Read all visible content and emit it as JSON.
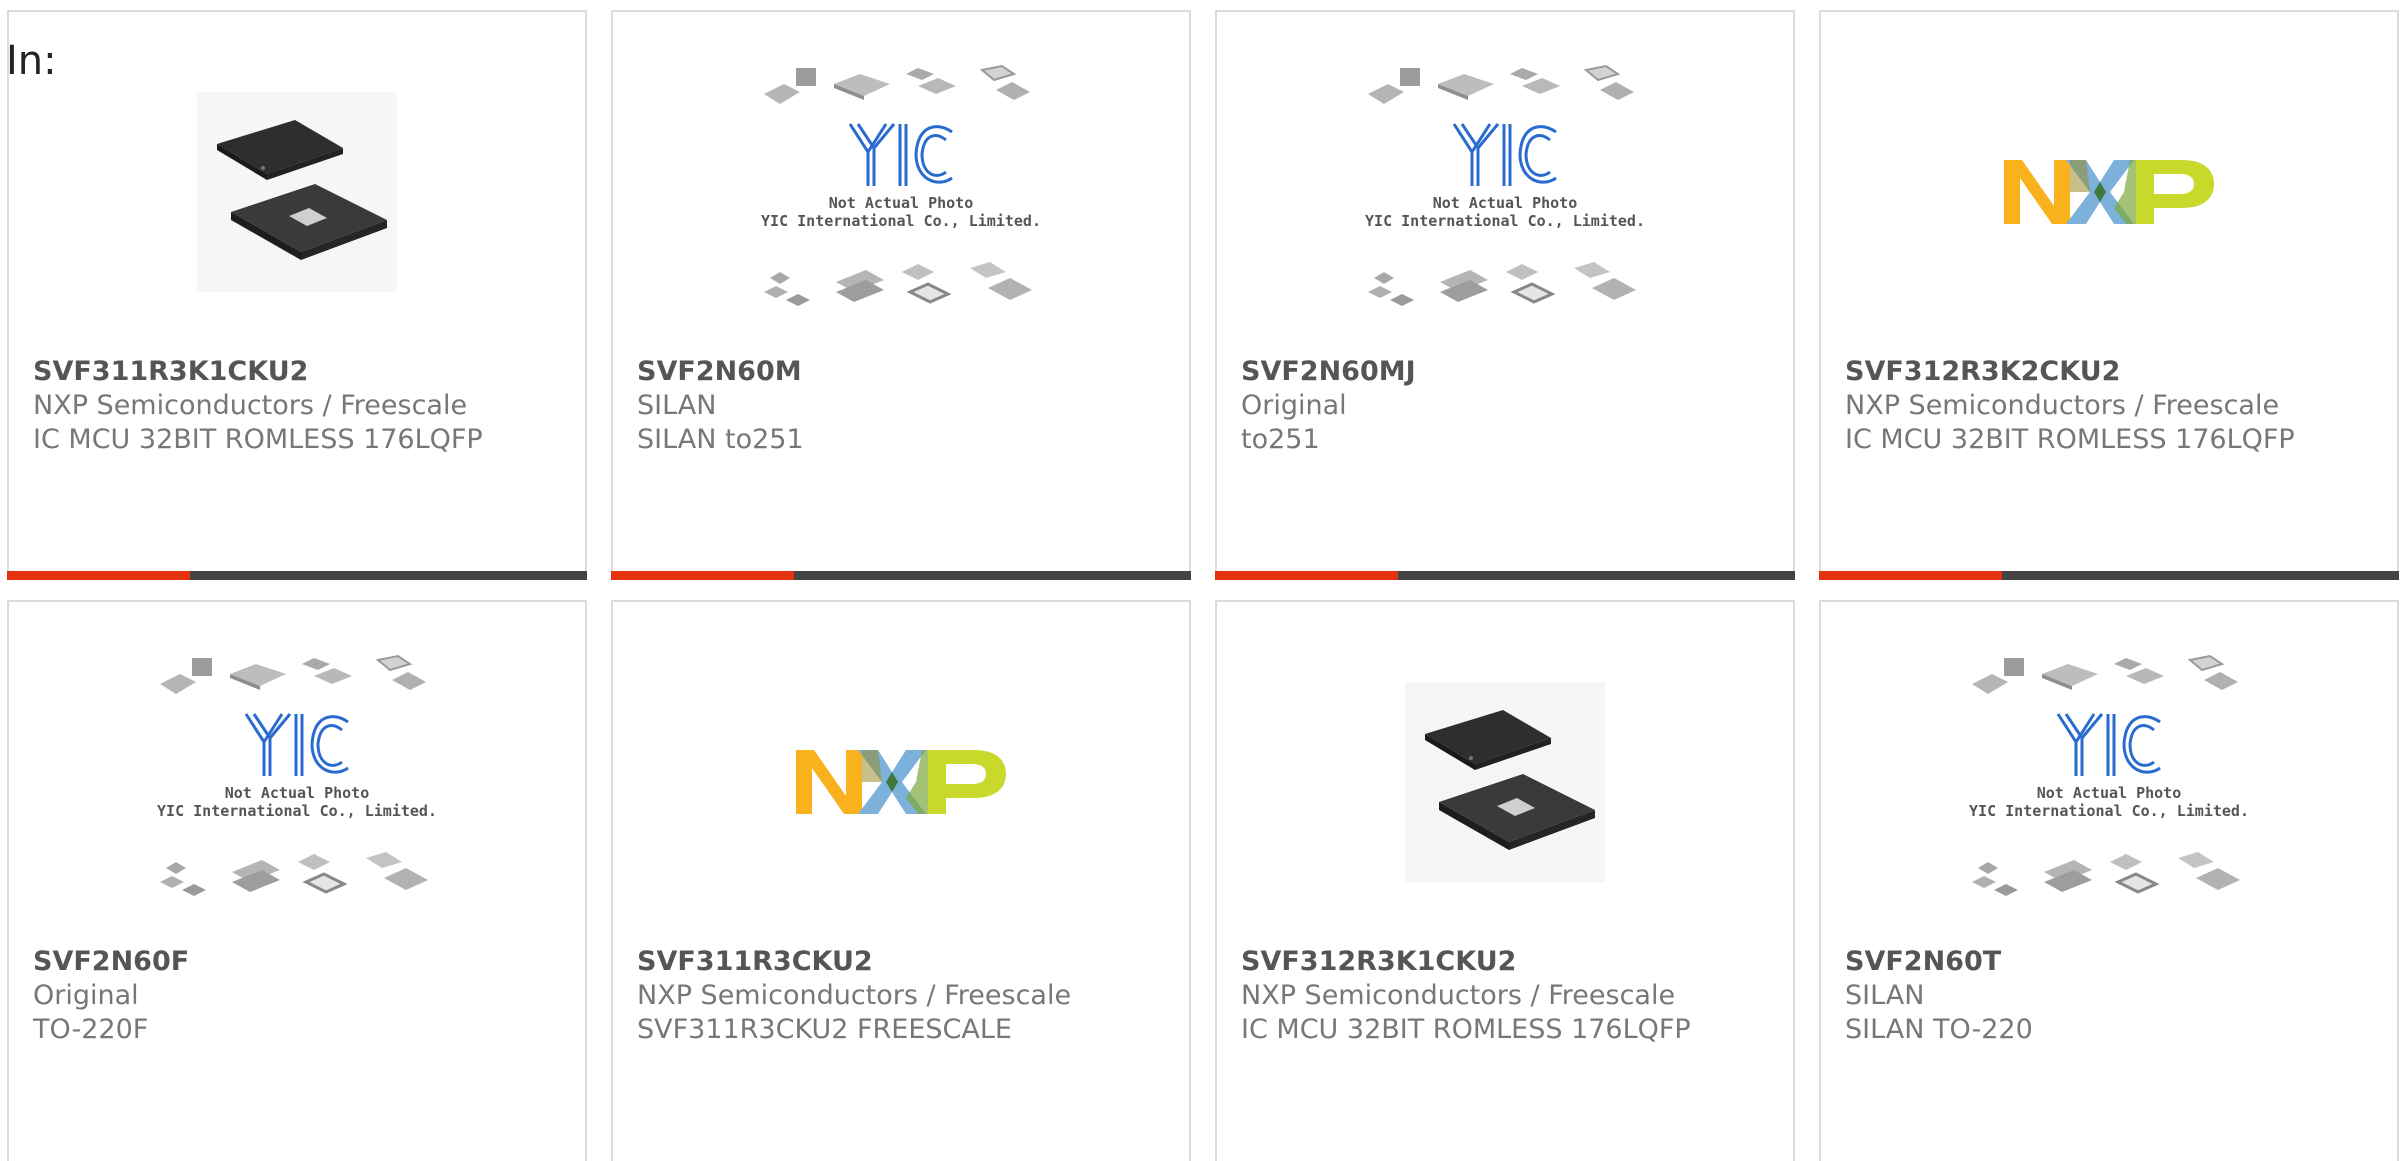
{
  "header": {
    "in_label": "In:"
  },
  "colors": {
    "accent": "#e4330e",
    "bar": "#444444",
    "border": "#dcdcdc"
  },
  "placeholder": {
    "line1": "Not Actual Photo",
    "line2": "YIC International Co., Limited.",
    "logo_text": "YIC"
  },
  "products": [
    {
      "part": "SVF311R3K1CKU2",
      "manufacturer": "NXP Semiconductors / Freescale",
      "description": "IC MCU 32BIT ROMLESS 176LQFP",
      "image": "chip-photo"
    },
    {
      "part": "SVF2N60M",
      "manufacturer": "SILAN",
      "description": "SILAN to251",
      "image": "yic-placeholder"
    },
    {
      "part": "SVF2N60MJ",
      "manufacturer": "Original",
      "description": "to251",
      "image": "yic-placeholder"
    },
    {
      "part": "SVF312R3K2CKU2",
      "manufacturer": "NXP Semiconductors / Freescale",
      "description": "IC MCU 32BIT ROMLESS 176LQFP",
      "image": "nxp-logo"
    },
    {
      "part": "SVF2N60F",
      "manufacturer": "Original",
      "description": "TO-220F",
      "image": "yic-placeholder"
    },
    {
      "part": "SVF311R3CKU2",
      "manufacturer": "NXP Semiconductors / Freescale",
      "description": "SVF311R3CKU2 FREESCALE",
      "image": "nxp-logo"
    },
    {
      "part": "SVF312R3K1CKU2",
      "manufacturer": "NXP Semiconductors / Freescale",
      "description": "IC MCU 32BIT ROMLESS 176LQFP",
      "image": "chip-photo"
    },
    {
      "part": "SVF2N60T",
      "manufacturer": "SILAN",
      "description": "SILAN TO-220",
      "image": "yic-placeholder"
    }
  ]
}
